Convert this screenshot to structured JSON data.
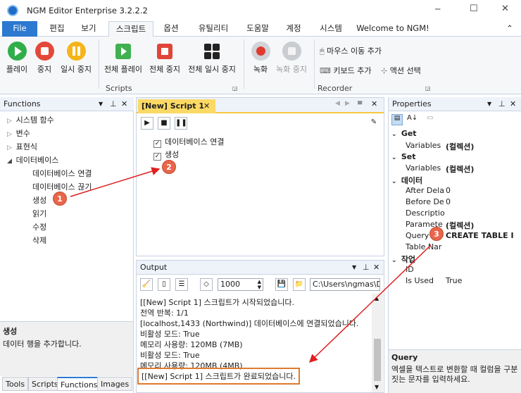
{
  "window": {
    "title": "NGM Editor Enterprise 3.2.2.2",
    "minimize": "─",
    "maximize": "☐",
    "close": "✕"
  },
  "menu": {
    "file": "File",
    "tabs": [
      "편집",
      "보기",
      "스크립트",
      "옵션",
      "유틸리티",
      "도움말",
      "계정",
      "시스템"
    ],
    "welcome": "Welcome to NGM!",
    "collapse": "⌃"
  },
  "ribbon": {
    "buttons": [
      "플레이",
      "중지",
      "일시 중지",
      "전체 플레이",
      "전체 중지",
      "전체 일시 중지",
      "녹화",
      "녹화 중지"
    ],
    "recorder_items": [
      "마우스 이동 추가",
      "키보드 추가",
      "액션 선택"
    ],
    "groups": {
      "scripts": "Scripts",
      "recorder": "Recorder"
    }
  },
  "functions": {
    "title": "Functions",
    "tree": [
      "시스템 함수",
      "변수",
      "표현식",
      "데이터베이스",
      "데이터베이스 연결",
      "데이터베이스 끊기",
      "생성",
      "읽기",
      "수정",
      "삭제"
    ],
    "desc_title": "생성",
    "desc_text": "데이터 행을 추가합니다."
  },
  "bottom_tabs": [
    "Tools",
    "Scripts",
    "Functions",
    "Images"
  ],
  "script": {
    "tab": "[New] Script 1",
    "steps": [
      "데이터베이스 연결",
      "생성"
    ]
  },
  "output": {
    "title": "Output",
    "count": "1000",
    "path": "C:\\Users\\ngmas\\D",
    "lines": [
      "[[New] Script 1] 스크립트가 시작되었습니다.",
      "전역 반복: 1/1",
      "[localhost,1433 (Northwind)] 데이터베이스에 연결되었습니다.",
      "비활성 모드: True",
      "메모리 사용량: 120MB (7MB)",
      "비활성 모드: True",
      "메모리 사용량: 120MB (4MB)",
      "[[New] Script 1] 스크립트가 완료되었습니다."
    ]
  },
  "properties": {
    "title": "Properties",
    "sections": [
      "Get",
      "Set",
      "데이터",
      "작업"
    ],
    "rows": [
      {
        "name": "Variables",
        "value": "(컬렉션)"
      },
      {
        "name": "Variables",
        "value": "(컬렉션)"
      },
      {
        "name": "After Dela",
        "value": "0"
      },
      {
        "name": "Before De",
        "value": "0"
      },
      {
        "name": "Descriptio",
        "value": ""
      },
      {
        "name": "Paramete",
        "value": "(컬렉션)"
      },
      {
        "name": "Query",
        "value": "CREATE TABLE I"
      },
      {
        "name": "Table Nar",
        "value": ""
      },
      {
        "name": "ID",
        "value": ""
      },
      {
        "name": "Is Used",
        "value": "True"
      }
    ],
    "desc_title": "Query",
    "desc_text": "엑셀을 텍스트로 변환할 때 컬럼을 구분짓는 문자를 입력하세요."
  },
  "annotations": [
    "1",
    "2",
    "3"
  ],
  "colors": {
    "accent": "#2b79d0",
    "highlight": "#e07a2e",
    "arrow": "#e02020"
  }
}
